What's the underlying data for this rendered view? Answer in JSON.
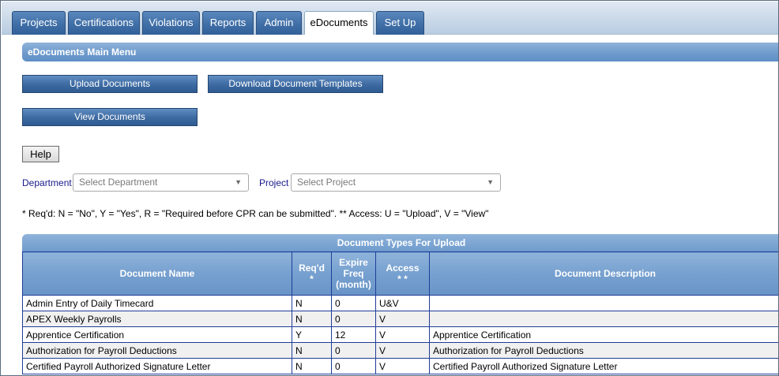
{
  "tabs": [
    {
      "label": "Projects"
    },
    {
      "label": "Certifications"
    },
    {
      "label": "Violations"
    },
    {
      "label": "Reports"
    },
    {
      "label": "Admin"
    },
    {
      "label": "eDocuments"
    },
    {
      "label": "Set Up"
    }
  ],
  "main": {
    "section_title": "eDocuments Main Menu",
    "upload_label": "Upload Documents",
    "download_label": "Download Document Templates",
    "view_label": "View Documents",
    "help_label": "Help"
  },
  "filters": {
    "department_label": "Department",
    "department_placeholder": "Select Department",
    "project_label": "Project",
    "project_placeholder": "Select Project"
  },
  "note": "* Req'd: N = \"No\", Y = \"Yes\", R = \"Required before CPR can be submitted\". ** Access: U = \"Upload\", V = \"View\"",
  "table": {
    "title": "Document Types For Upload",
    "headers": {
      "name": "Document Name",
      "reqd": "Req'd",
      "reqd_mark": "*",
      "expire": "Expire Freq (month)",
      "access": "Access",
      "access_mark": "* *",
      "description": "Document Description"
    },
    "rows": [
      {
        "name": "Admin Entry of Daily Timecard",
        "reqd": "N",
        "expire": "0",
        "access": "U&V",
        "description": ""
      },
      {
        "name": "APEX Weekly Payrolls",
        "reqd": "N",
        "expire": "0",
        "access": "V",
        "description": ""
      },
      {
        "name": "Apprentice Certification",
        "reqd": "Y",
        "expire": "12",
        "access": "V",
        "description": "Apprentice Certification"
      },
      {
        "name": "Authorization for Payroll Deductions",
        "reqd": "N",
        "expire": "0",
        "access": "V",
        "description": "Authorization for Payroll Deductions"
      },
      {
        "name": "Certified Payroll Authorized Signature Letter",
        "reqd": "N",
        "expire": "0",
        "access": "V",
        "description": "Certified Payroll Authorized Signature Letter"
      }
    ]
  },
  "icons": {
    "dropdown": "chevron-down-icon"
  }
}
